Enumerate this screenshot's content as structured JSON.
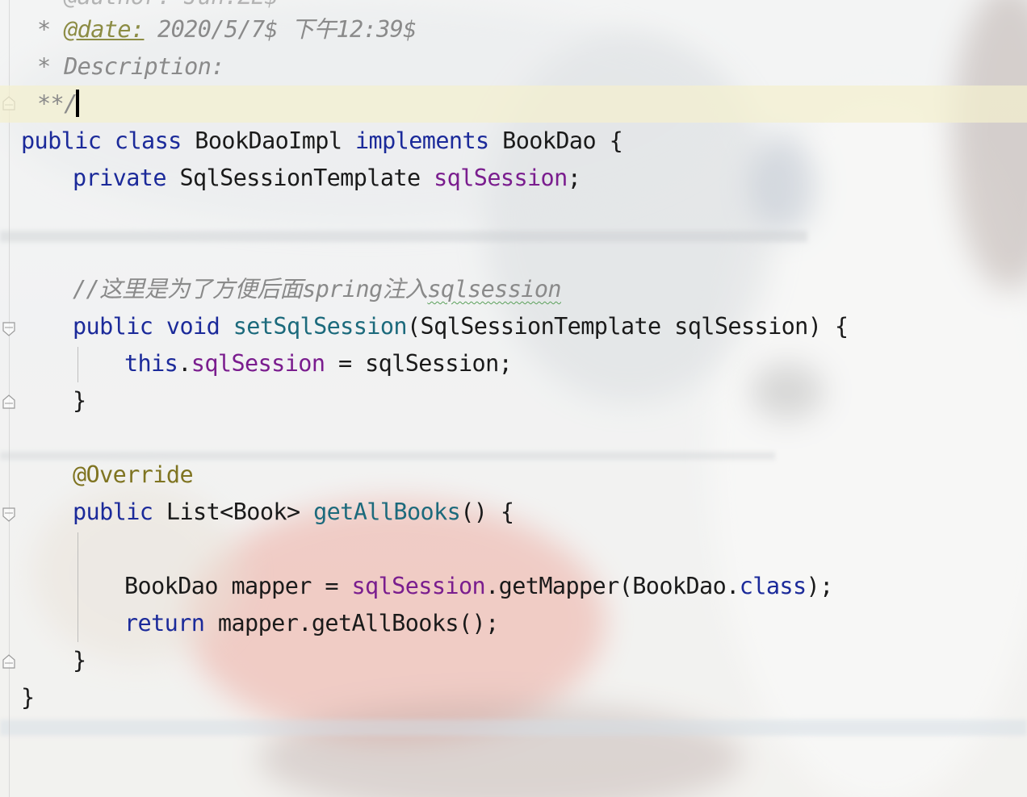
{
  "editor": {
    "lines": {
      "l0": {
        "text": "* @author: Jun.ZE$"
      },
      "l1": {
        "star": "* ",
        "tag": "@date:",
        "rest": " 2020/5/7$ 下午12:39$"
      },
      "l2": {
        "text": "* Description:"
      },
      "l3": {
        "text": "**/"
      },
      "l4": {
        "t1": "public",
        "t2": " ",
        "t3": "class",
        "t4": " BookDaoImpl ",
        "t5": "implements",
        "t6": " BookDao {"
      },
      "l5": {
        "t1": "private",
        "t2": " SqlSessionTemplate ",
        "t3": "sqlSession",
        "t4": ";"
      },
      "l8": {
        "t1": "//这里是为了方便后面spring注入",
        "t2": "sqlsession"
      },
      "l9": {
        "t1": "public",
        "t2": " ",
        "t3": "void",
        "t4": " ",
        "t5": "setSqlSession",
        "t6": "(SqlSessionTemplate sqlSession) {"
      },
      "l10": {
        "t1": "this",
        "t2": ".",
        "t3": "sqlSession",
        "t4": " = sqlSession;"
      },
      "l11": {
        "text": "}"
      },
      "l13": {
        "text": "@Override"
      },
      "l14": {
        "t1": "public",
        "t2": " List<Book> ",
        "t3": "getAllBooks",
        "t4": "() {"
      },
      "l16": {
        "t1": "BookDao mapper = ",
        "t2": "sqlSession",
        "t3": ".getMapper(BookDao.",
        "t4": "class",
        "t5": ");"
      },
      "l17": {
        "t1": "return",
        "t2": " mapper.getAllBooks();"
      },
      "l18": {
        "text": "}"
      },
      "l19": {
        "text": "}"
      }
    }
  },
  "colors": {
    "keyword": "#1b2a9a",
    "field": "#7a1d8e",
    "method": "#1c6a7c",
    "comment": "#8a8a8a",
    "annotation": "#7f7421",
    "caret_line": "#f4f0ce"
  },
  "icons": {
    "fold_start": "fold-start-icon",
    "fold_end": "fold-end-icon"
  }
}
